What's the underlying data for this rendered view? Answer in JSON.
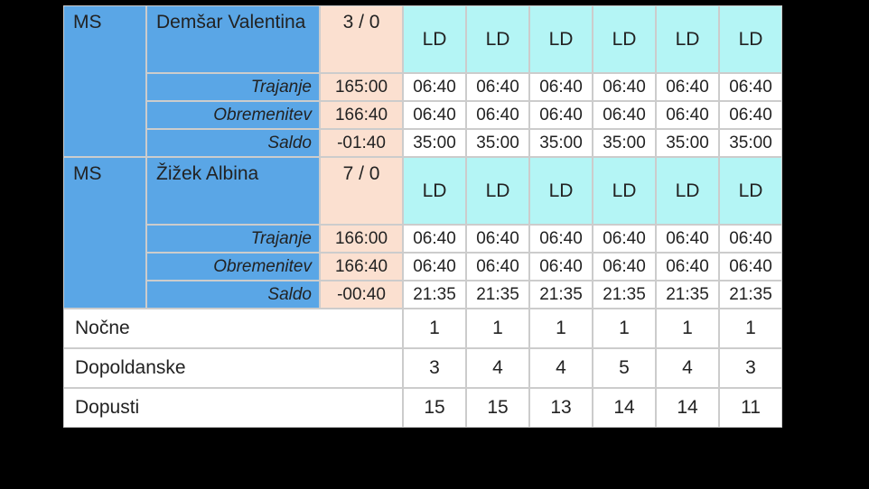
{
  "labels": {
    "trajanje": "Trajanje",
    "obremenitev": "Obremenitev",
    "saldo": "Saldo"
  },
  "employees": [
    {
      "role": "MS",
      "name": "Demšar Valentina",
      "ratio": "3 / 0",
      "shift": [
        "LD",
        "LD",
        "LD",
        "LD",
        "LD",
        "LD"
      ],
      "trajanje": {
        "total": "165:00",
        "days": [
          "06:40",
          "06:40",
          "06:40",
          "06:40",
          "06:40",
          "06:40"
        ]
      },
      "obremenitev": {
        "total": "166:40",
        "days": [
          "06:40",
          "06:40",
          "06:40",
          "06:40",
          "06:40",
          "06:40"
        ]
      },
      "saldo": {
        "total": "-01:40",
        "days": [
          "35:00",
          "35:00",
          "35:00",
          "35:00",
          "35:00",
          "35:00"
        ]
      }
    },
    {
      "role": "MS",
      "name": "Žižek Albina",
      "ratio": "7 / 0",
      "shift": [
        "LD",
        "LD",
        "LD",
        "LD",
        "LD",
        "LD"
      ],
      "trajanje": {
        "total": "166:00",
        "days": [
          "06:40",
          "06:40",
          "06:40",
          "06:40",
          "06:40",
          "06:40"
        ]
      },
      "obremenitev": {
        "total": "166:40",
        "days": [
          "06:40",
          "06:40",
          "06:40",
          "06:40",
          "06:40",
          "06:40"
        ]
      },
      "saldo": {
        "total": "-00:40",
        "days": [
          "21:35",
          "21:35",
          "21:35",
          "21:35",
          "21:35",
          "21:35"
        ]
      }
    }
  ],
  "summary": [
    {
      "label": "Nočne",
      "days": [
        "1",
        "1",
        "1",
        "1",
        "1",
        "1"
      ]
    },
    {
      "label": "Dopoldanske",
      "days": [
        "3",
        "4",
        "4",
        "5",
        "4",
        "3"
      ]
    },
    {
      "label": "Dopusti",
      "days": [
        "15",
        "15",
        "13",
        "14",
        "14",
        "11"
      ]
    }
  ]
}
